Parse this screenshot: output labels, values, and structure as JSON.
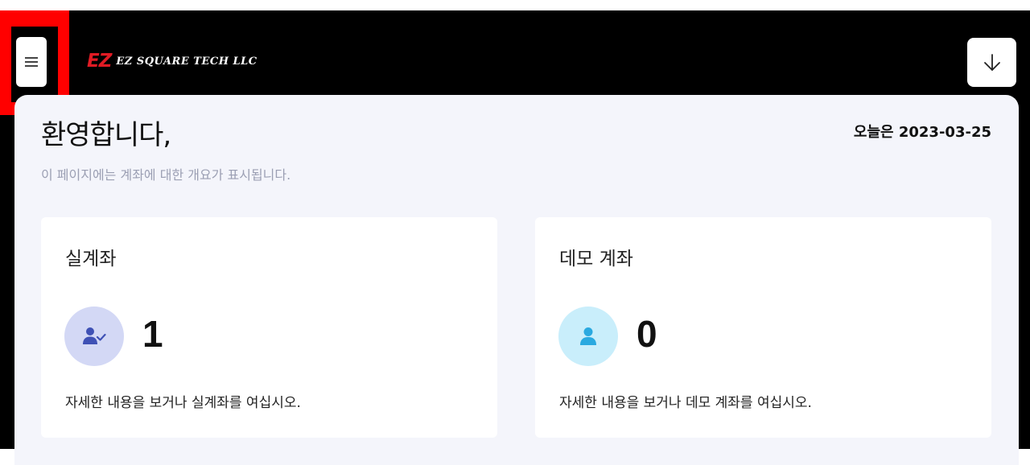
{
  "header": {
    "logo_mark": "EZ",
    "logo_text": "EZ SQUARE TECH LLC",
    "menu_icon": "hamburger-menu-icon",
    "download_icon": "arrow-down-icon"
  },
  "dashboard": {
    "welcome": "환영합니다,",
    "date_label": "오늘은 2023-03-25",
    "subtitle": "이 페이지에는 계좌에 대한 개요가 표시됩니다."
  },
  "cards": [
    {
      "title": "실계좌",
      "count": "1",
      "description": "자세한 내용을 보거나 실계좌를 여십시오.",
      "icon": "user-check-icon",
      "avatar_bg": "#d3d8f5",
      "icon_color": "#3f51b5"
    },
    {
      "title": "데모 계좌",
      "count": "0",
      "description": "자세한 내용을 보거나 데모 계좌를 여십시오.",
      "icon": "user-icon",
      "avatar_bg": "#c9eefb",
      "icon_color": "#2aa9e0"
    }
  ],
  "colors": {
    "brand_red": "#e01b24",
    "highlight": "#ff0000",
    "panel_bg": "#f4f5fb",
    "subtitle_gray": "#9b9fb3"
  }
}
